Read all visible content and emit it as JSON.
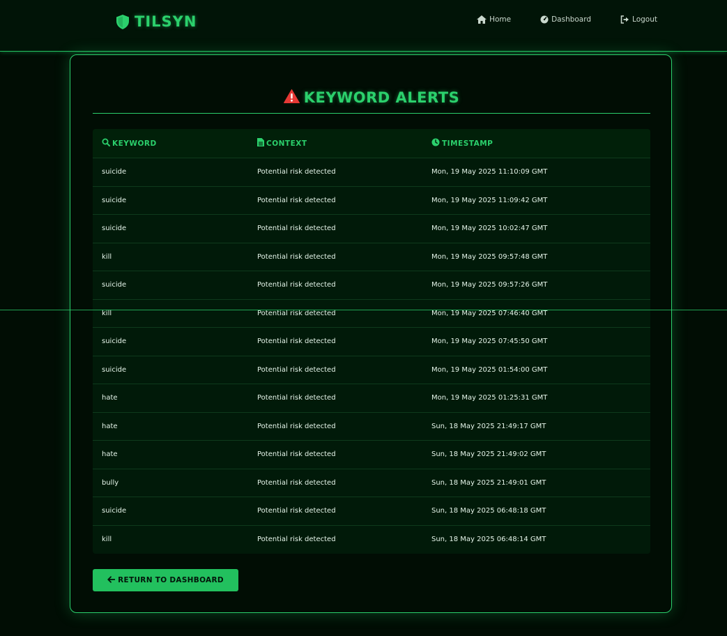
{
  "brand": {
    "name": "TILSYN",
    "icon": "shield-icon"
  },
  "nav": [
    {
      "label": "Home",
      "icon": "home-icon"
    },
    {
      "label": "Dashboard",
      "icon": "gauge-icon"
    },
    {
      "label": "Logout",
      "icon": "logout-icon"
    }
  ],
  "page": {
    "title": "KEYWORD ALERTS",
    "title_icon": "warning-icon"
  },
  "table": {
    "headers": [
      {
        "label": "KEYWORD",
        "icon": "search-icon"
      },
      {
        "label": "CONTEXT",
        "icon": "file-icon"
      },
      {
        "label": "TIMESTAMP",
        "icon": "clock-icon"
      }
    ],
    "rows": [
      {
        "keyword": "suicide",
        "context": "Potential risk detected",
        "timestamp": "Mon, 19 May 2025 11:10:09 GMT"
      },
      {
        "keyword": "suicide",
        "context": "Potential risk detected",
        "timestamp": "Mon, 19 May 2025 11:09:42 GMT"
      },
      {
        "keyword": "suicide",
        "context": "Potential risk detected",
        "timestamp": "Mon, 19 May 2025 10:02:47 GMT"
      },
      {
        "keyword": "kill",
        "context": "Potential risk detected",
        "timestamp": "Mon, 19 May 2025 09:57:48 GMT"
      },
      {
        "keyword": "suicide",
        "context": "Potential risk detected",
        "timestamp": "Mon, 19 May 2025 09:57:26 GMT"
      },
      {
        "keyword": "kill",
        "context": "Potential risk detected",
        "timestamp": "Mon, 19 May 2025 07:46:40 GMT"
      },
      {
        "keyword": "suicide",
        "context": "Potential risk detected",
        "timestamp": "Mon, 19 May 2025 07:45:50 GMT"
      },
      {
        "keyword": "suicide",
        "context": "Potential risk detected",
        "timestamp": "Mon, 19 May 2025 01:54:00 GMT"
      },
      {
        "keyword": "hate",
        "context": "Potential risk detected",
        "timestamp": "Mon, 19 May 2025 01:25:31 GMT"
      },
      {
        "keyword": "hate",
        "context": "Potential risk detected",
        "timestamp": "Sun, 18 May 2025 21:49:17 GMT"
      },
      {
        "keyword": "hate",
        "context": "Potential risk detected",
        "timestamp": "Sun, 18 May 2025 21:49:02 GMT"
      },
      {
        "keyword": "bully",
        "context": "Potential risk detected",
        "timestamp": "Sun, 18 May 2025 21:49:01 GMT"
      },
      {
        "keyword": "suicide",
        "context": "Potential risk detected",
        "timestamp": "Sun, 18 May 2025 06:48:18 GMT"
      },
      {
        "keyword": "kill",
        "context": "Potential risk detected",
        "timestamp": "Sun, 18 May 2025 06:48:14 GMT"
      }
    ]
  },
  "return_button": {
    "label": "RETURN TO DASHBOARD",
    "icon": "arrow-left-icon"
  },
  "colors": {
    "accent": "#2bd06c",
    "background": "#010d04",
    "button": "#22c05e",
    "warning": "#e53935"
  }
}
